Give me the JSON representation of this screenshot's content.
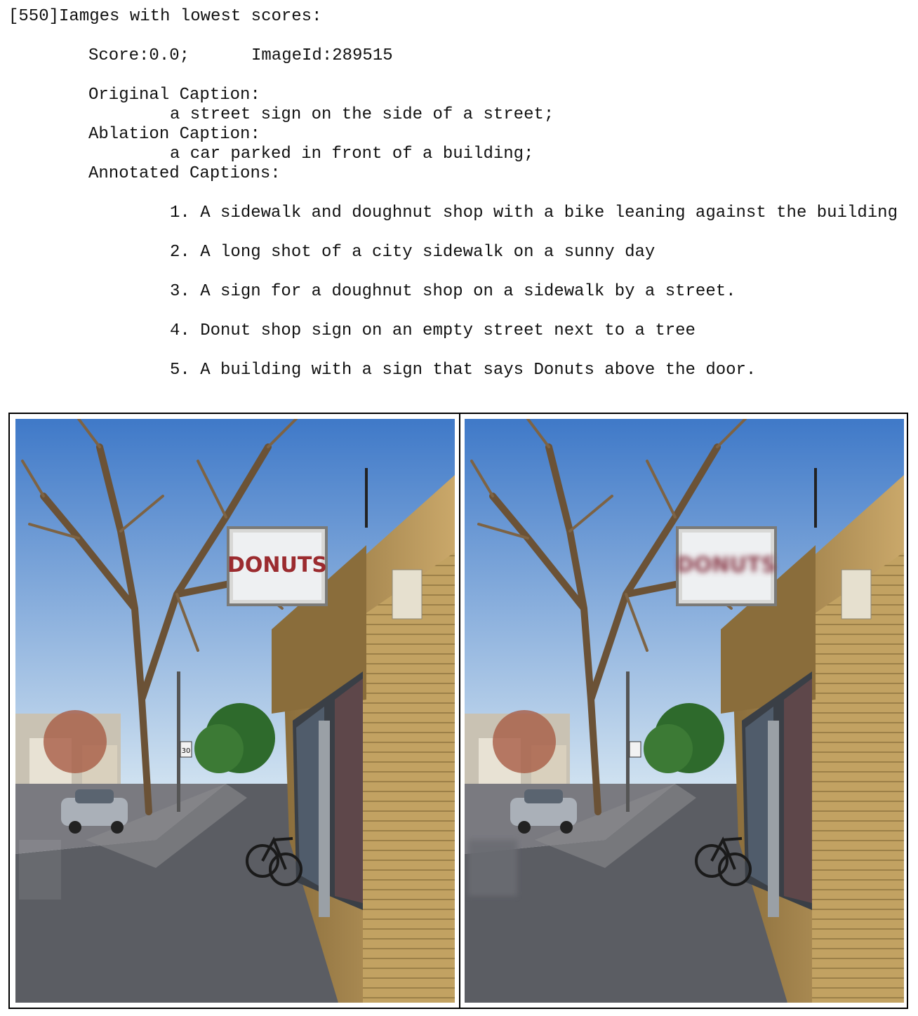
{
  "header": {
    "cell_prompt": "[550]",
    "heading": "Iamges with lowest scores:"
  },
  "result": {
    "score_text": "Score:0.0;",
    "image_id_text": "ImageId:289515",
    "original_caption_label": "Original Caption:",
    "original_caption": "a street sign on the side of a street;",
    "ablation_caption_label": "Ablation Caption:",
    "ablation_caption": "a car parked in front of a building;",
    "annotated_captions_label": "Annotated Captions:",
    "annotated_captions": [
      "1. A sidewalk and doughnut shop with a bike leaning against the building",
      "2. A long shot of a city sidewalk on a sunny day",
      "3. A sign for a doughnut shop on a sidewalk by a street.",
      "4. Donut shop sign on an empty street next to a tree",
      "5. A building with a sign that says Donuts above the door."
    ]
  },
  "images": {
    "left_sign_text": "DONUTS",
    "right_sign_text": "DONUTS",
    "speed_sign_text": "30",
    "colors": {
      "sky_top": "#3f79c8",
      "sky_bottom": "#c7dcef",
      "brick": "#b89a5a",
      "brick_shadow": "#7c6333",
      "pavement": "#5b5d63",
      "sign_letters": "#9b2b2f",
      "tree_branch": "#6b5236",
      "hedge": "#2e6a2c"
    }
  }
}
